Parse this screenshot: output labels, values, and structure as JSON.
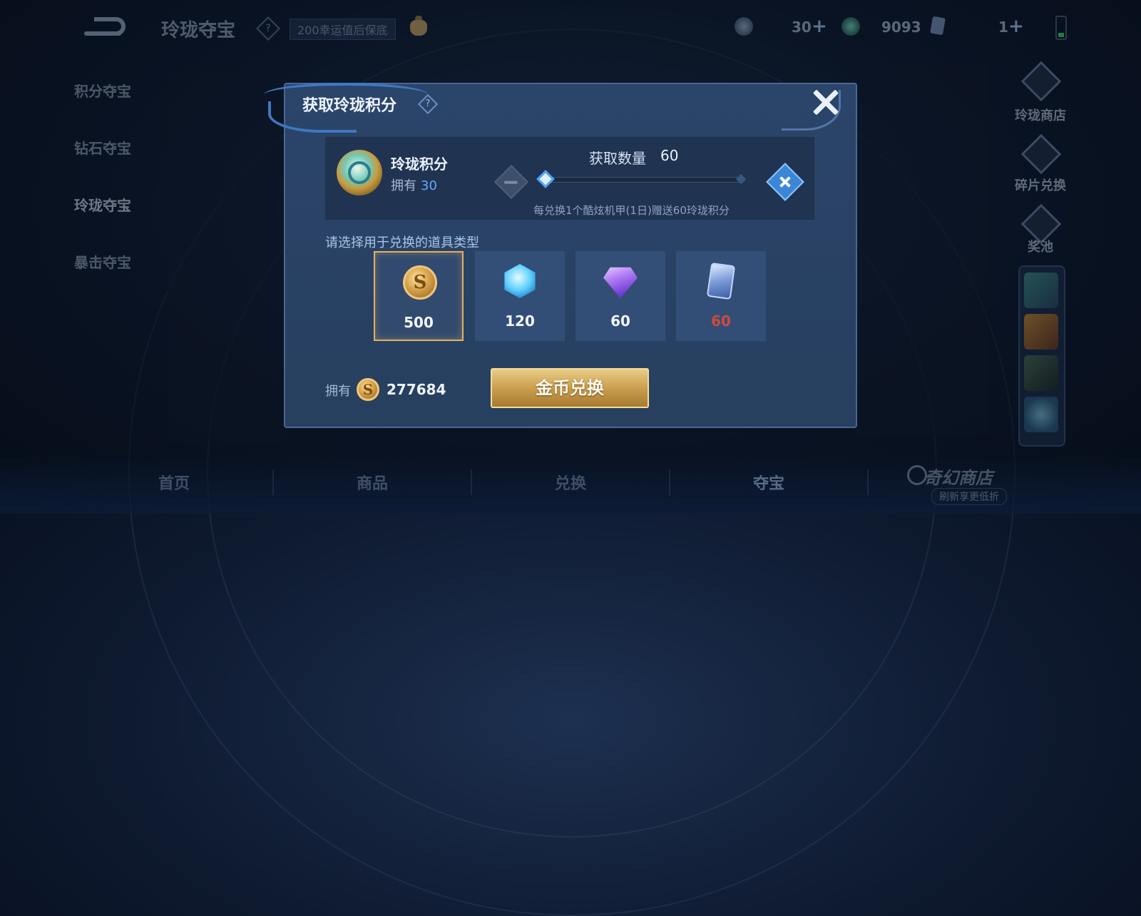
{
  "header": {
    "title": "玲珑夺宝",
    "note": "200幸运值后保底",
    "resources": [
      {
        "value": "30"
      },
      {
        "value": "9093"
      },
      {
        "value": "1"
      }
    ]
  },
  "left_nav": {
    "items": [
      {
        "label": "积分夺宝"
      },
      {
        "label": "钻石夺宝"
      },
      {
        "label": "玲珑夺宝"
      },
      {
        "label": "暴击夺宝"
      }
    ]
  },
  "right_nav": {
    "items": [
      {
        "label": "玲珑商店"
      },
      {
        "label": "碎片兑换"
      },
      {
        "label": "奖池"
      }
    ]
  },
  "bottom_nav": {
    "tabs": [
      {
        "label": "首页"
      },
      {
        "label": "商品"
      },
      {
        "label": "兑换"
      },
      {
        "label": "夺宝"
      }
    ],
    "brand": "奇幻商店",
    "brand_sub": "刷新享更低折"
  },
  "modal": {
    "title": "获取玲珑积分",
    "points": {
      "name": "玲珑积分",
      "have_label": "拥有",
      "have_value": "30"
    },
    "quantity": {
      "label": "获取数量",
      "value": "60",
      "slider_level": 0.0,
      "note": "每兑换1个酷炫机甲(1日)赠送60玲珑积分"
    },
    "choose_label": "请选择用于兑换的道具类型",
    "items": [
      {
        "icon": "gold-coin-icon",
        "value": "500",
        "selected": true
      },
      {
        "icon": "crystal-icon",
        "value": "120",
        "selected": false
      },
      {
        "icon": "diamond-icon",
        "value": "60",
        "selected": false
      },
      {
        "icon": "card-icon",
        "value": "60",
        "selected": false,
        "insufficient": true
      }
    ],
    "coins": {
      "label": "拥有",
      "value": "277684"
    },
    "confirm_button": "金币兑换"
  },
  "colors": {
    "accent_blue": "#5fa8ff",
    "gold": "#e2b261",
    "insufficient_red": "#d04a3c"
  }
}
